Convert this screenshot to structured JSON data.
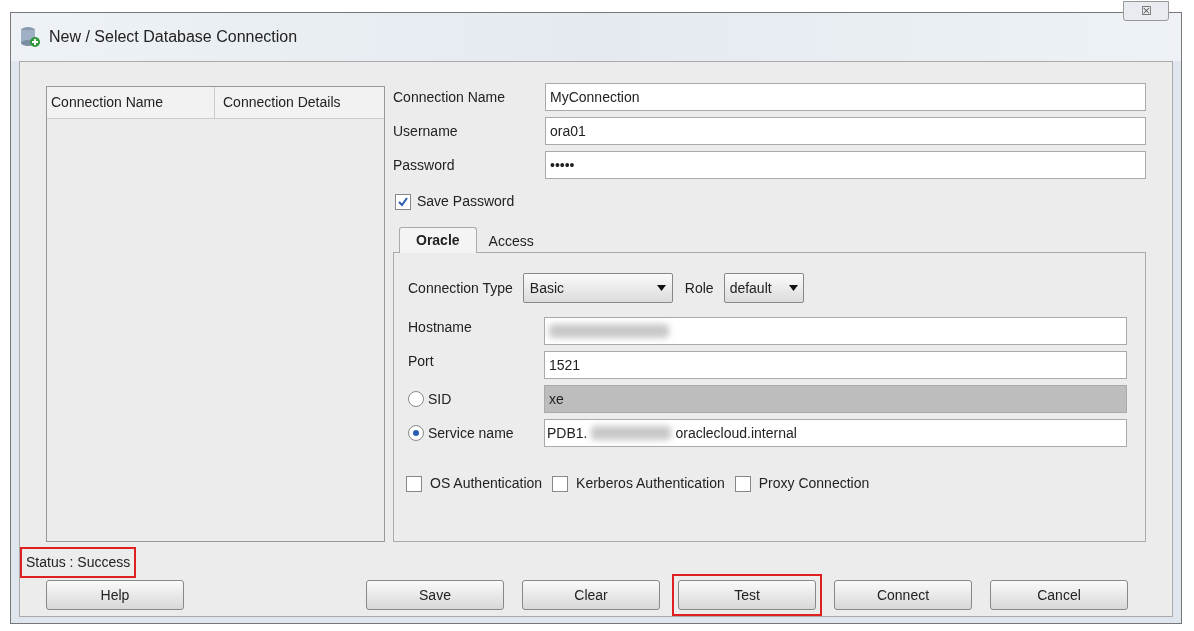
{
  "window": {
    "title": "New / Select Database Connection",
    "close": "☒"
  },
  "connections_table": {
    "columns": [
      "Connection Name",
      "Connection Details"
    ]
  },
  "fields": [
    {
      "label": "Connection Name",
      "value": "MyConnection"
    },
    {
      "label": "Username",
      "value": "ora01"
    },
    {
      "label": "Password",
      "value": "•••••"
    }
  ],
  "save_password": {
    "label": "Save Password",
    "checked": true
  },
  "tabs": [
    {
      "label": "Oracle",
      "selected": true
    },
    {
      "label": "Access",
      "selected": false
    }
  ],
  "connection_type": {
    "label": "Connection Type",
    "value": "Basic"
  },
  "role": {
    "label": "Role",
    "value": "default"
  },
  "hostname": {
    "label": "Hostname",
    "blurred": true
  },
  "port": {
    "label": "Port",
    "value": "1521"
  },
  "sid": {
    "label": "SID",
    "value": "xe",
    "selected": false
  },
  "service_name": {
    "label": "Service name",
    "value_start": "PDB1.",
    "blurred": true,
    "value_end": "oraclecloud.internal",
    "selected": true
  },
  "options": [
    {
      "label": "OS Authentication",
      "checked": false
    },
    {
      "label": "Kerberos Authentication",
      "checked": false
    },
    {
      "label": "Proxy Connection",
      "checked": false
    }
  ],
  "status": {
    "text": "Status : Success",
    "highlighted": true
  },
  "buttons": [
    {
      "label": "Help",
      "highlighted": false
    },
    {
      "label": "Save",
      "highlighted": false
    },
    {
      "label": "Clear",
      "highlighted": false
    },
    {
      "label": "Test",
      "highlighted": true
    },
    {
      "label": "Connect",
      "highlighted": false
    },
    {
      "label": "Cancel",
      "highlighted": false
    }
  ]
}
